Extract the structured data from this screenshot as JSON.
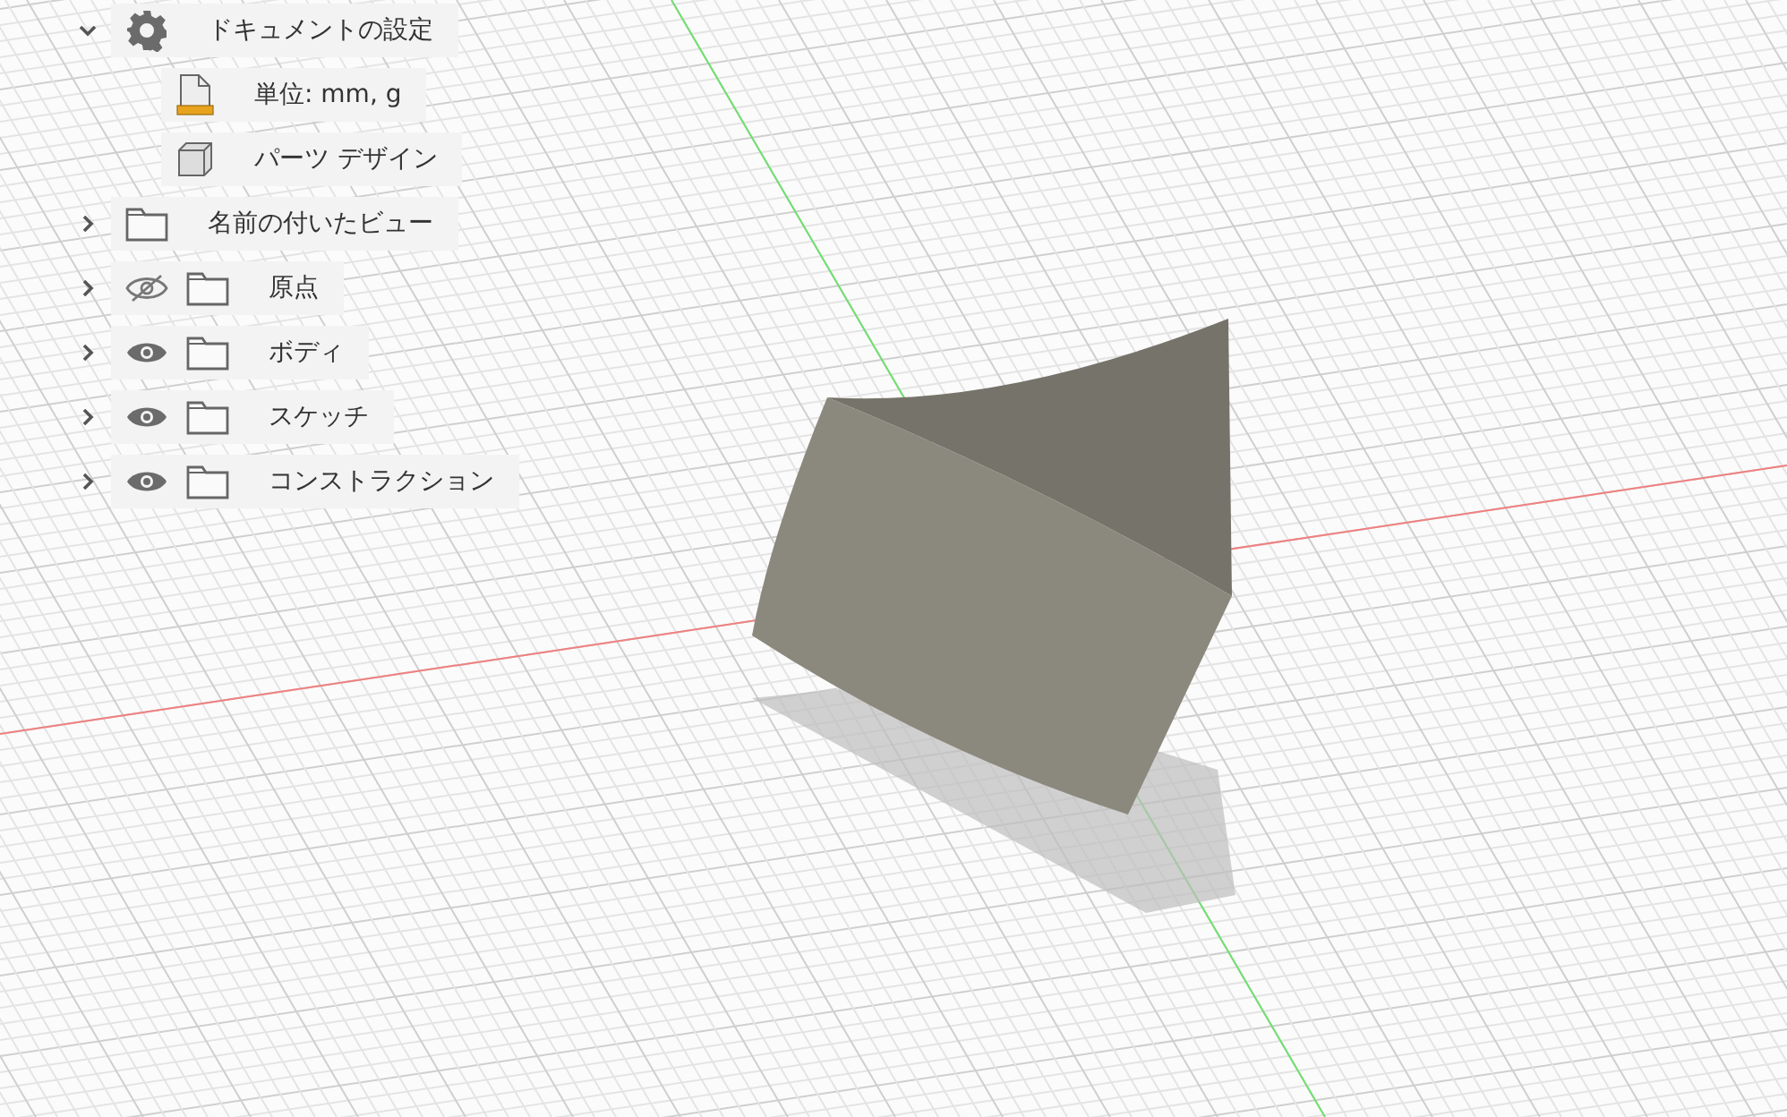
{
  "browser": {
    "items": [
      {
        "label": "ドキュメントの設定",
        "kind": "settings",
        "expanded": true,
        "children": [
          {
            "label": "単位: mm, g",
            "kind": "units"
          },
          {
            "label": "パーツ デザイン",
            "kind": "component"
          }
        ]
      },
      {
        "label": "名前の付いたビュー",
        "kind": "folder",
        "expanded": false
      },
      {
        "label": "原点",
        "kind": "folder",
        "expanded": false,
        "visible": false
      },
      {
        "label": "ボディ",
        "kind": "folder",
        "expanded": false,
        "visible": true
      },
      {
        "label": "スケッチ",
        "kind": "folder",
        "expanded": false,
        "visible": true
      },
      {
        "label": "コンストラクション",
        "kind": "folder",
        "expanded": false,
        "visible": true
      }
    ]
  }
}
